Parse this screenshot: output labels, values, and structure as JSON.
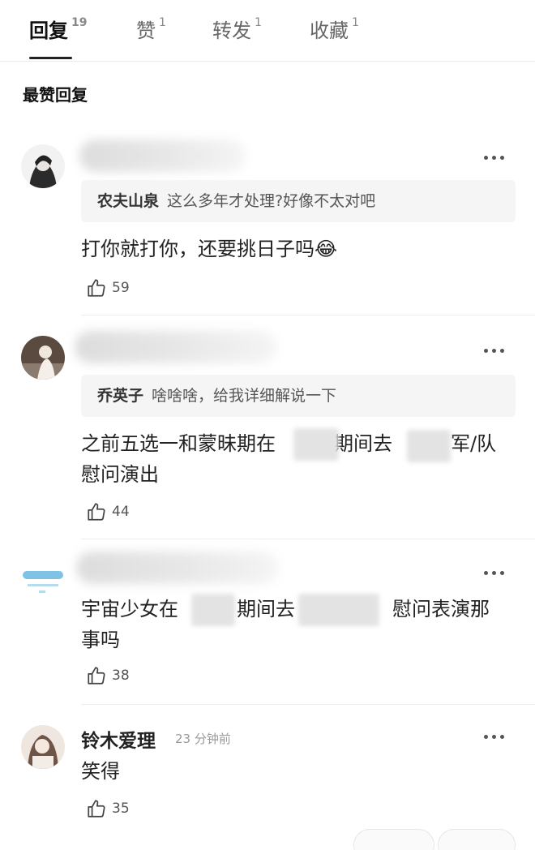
{
  "tabs": [
    {
      "label": "回复",
      "count": "19",
      "active": true
    },
    {
      "label": "赞",
      "count": "1",
      "active": false
    },
    {
      "label": "转发",
      "count": "1",
      "active": false
    },
    {
      "label": "收藏",
      "count": "1",
      "active": false
    }
  ],
  "section_title": "最赞回复",
  "comments": [
    {
      "quote_name": "农夫山泉",
      "quote_text": "这么多年才处理?好像不太对吧",
      "text": "打你就打你，还要挑日子吗😂",
      "likes": "59"
    },
    {
      "quote_name": "乔英子",
      "quote_text": "啥啥啥，给我详细解说一下",
      "text": "之前五选一和蒙昧期在　　　期间去　　　军/队\n慰问演出",
      "likes": "44"
    },
    {
      "text": "宇宙少女在　　　期间去　　　　　慰问表演那\n事吗",
      "likes": "38"
    },
    {
      "author": "铃木爱理",
      "time": "23 分钟前",
      "text": "笑得",
      "likes": "35"
    }
  ],
  "icons": {
    "more": "more-horizontal-icon",
    "like": "thumbs-up-icon"
  }
}
